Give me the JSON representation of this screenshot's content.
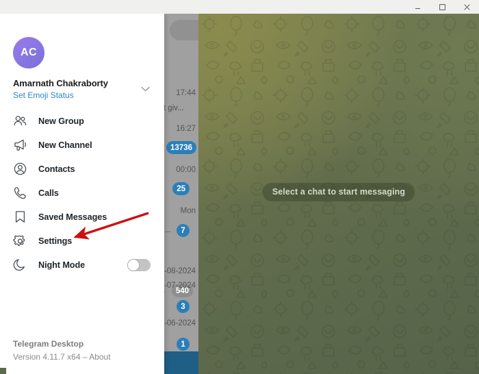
{
  "window": {
    "controls": [
      {
        "name": "minimize",
        "glyph": "—"
      },
      {
        "name": "maximize",
        "glyph": "□"
      },
      {
        "name": "close",
        "glyph": "✕"
      }
    ]
  },
  "menu": {
    "account": {
      "avatar_initials": "AC",
      "name": "Amarnath Chakraborty",
      "status_link": "Set Emoji Status",
      "expand_icon": "chevron-down-icon"
    },
    "items": [
      {
        "icon": "new-group-icon",
        "label": "New Group"
      },
      {
        "icon": "new-channel-icon",
        "label": "New Channel"
      },
      {
        "icon": "contacts-icon",
        "label": "Contacts"
      },
      {
        "icon": "calls-icon",
        "label": "Calls"
      },
      {
        "icon": "saved-messages-icon",
        "label": "Saved Messages"
      },
      {
        "icon": "settings-icon",
        "label": "Settings"
      },
      {
        "icon": "night-mode-icon",
        "label": "Night Mode",
        "toggle": true,
        "toggle_on": false
      }
    ],
    "footer": {
      "app_name": "Telegram Desktop",
      "version_line": "Version 4.11.7 x64 – About"
    }
  },
  "chat_list": {
    "rows": [
      {
        "time": "17:44",
        "preview": "not giv...",
        "badge": null,
        "badge_style": null
      },
      {
        "time": "16:27",
        "preview": "...",
        "badge": "13736",
        "badge_style": "blue"
      },
      {
        "time": "00:00",
        "preview": "",
        "badge": "25",
        "badge_style": "blue"
      },
      {
        "time": "Mon",
        "preview": "o...",
        "badge": "7",
        "badge_style": "blue"
      },
      {
        "time": "-08-2024",
        "preview": "...",
        "badge": "540",
        "badge_style": "gray"
      },
      {
        "time": "-07-2024",
        "preview": "",
        "badge": "3",
        "badge_style": "blue"
      },
      {
        "time": "-06-2024",
        "preview": "",
        "badge": "1",
        "badge_style": "blue"
      }
    ]
  },
  "chat_pane": {
    "empty_state": "Select a chat to start messaging"
  },
  "annotation": {
    "arrow_color": "#cc1111",
    "points_to": "Settings"
  },
  "colors": {
    "accent_blue": "#2b87c9",
    "badge_blue": "#2b7fb8",
    "avatar_purple": "#8b77e4",
    "menu_bg": "#ffffff",
    "chat_bg_green": "#626d4c",
    "arrow_red": "#cc1111"
  }
}
